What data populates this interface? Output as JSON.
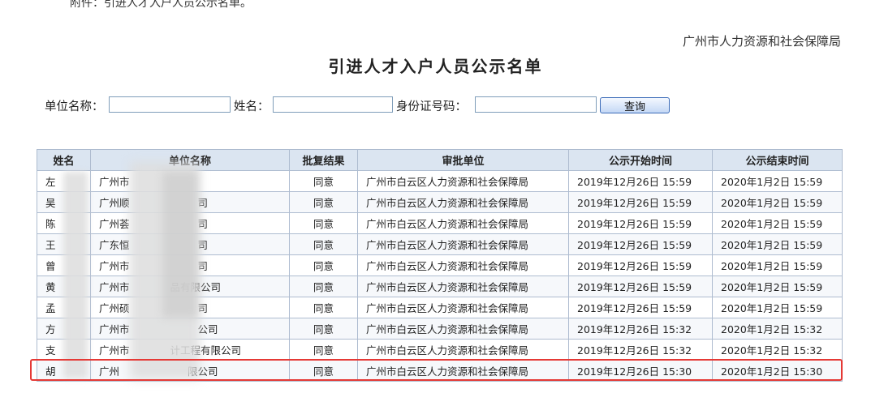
{
  "attachment_text": "附件：引进人才入户人员公示名单。",
  "issuer": "广州市人力资源和社会保障局",
  "page_title": "引进人才入户人员公示名单",
  "search": {
    "unit_label": "单位名称：",
    "unit_value": "",
    "name_label": "姓名：",
    "name_value": "",
    "id_label": "身份证号码：",
    "id_value": "",
    "button_label": "查询"
  },
  "table": {
    "headers": [
      "姓名",
      "单位名称",
      "批复结果",
      "审批单位",
      "公示开始时间",
      "公示结束时间"
    ],
    "rows": [
      {
        "name": "左",
        "unit": "广州市",
        "result": "同意",
        "dept": "广州市白云区人力资源和社会保障局",
        "start": "2019年12月26日  15:59",
        "end": "2020年1月2日  15:59"
      },
      {
        "name": "吴",
        "unit": "广州顺",
        "unit_tail": "司",
        "result": "同意",
        "dept": "广州市白云区人力资源和社会保障局",
        "start": "2019年12月26日  15:59",
        "end": "2020年1月2日  15:59"
      },
      {
        "name": "陈",
        "unit": "广州荟",
        "unit_tail": "司",
        "result": "同意",
        "dept": "广州市白云区人力资源和社会保障局",
        "start": "2019年12月26日  15:59",
        "end": "2020年1月2日  15:59"
      },
      {
        "name": "王",
        "unit": "广东恒",
        "unit_tail": "司",
        "result": "同意",
        "dept": "广州市白云区人力资源和社会保障局",
        "start": "2019年12月26日  15:59",
        "end": "2020年1月2日  15:59"
      },
      {
        "name": "曾",
        "unit": "广州市",
        "unit_tail": "司",
        "result": "同意",
        "dept": "广州市白云区人力资源和社会保障局",
        "start": "2019年12月26日  15:59",
        "end": "2020年1月2日  15:59"
      },
      {
        "name": "黄",
        "unit": "广州市",
        "unit_tail": "品有限公司",
        "result": "同意",
        "dept": "广州市白云区人力资源和社会保障局",
        "start": "2019年12月26日  15:59",
        "end": "2020年1月2日  15:59"
      },
      {
        "name": "孟",
        "unit": "广州硕",
        "unit_tail": "司",
        "result": "同意",
        "dept": "广州市白云区人力资源和社会保障局",
        "start": "2019年12月26日  15:59",
        "end": "2020年1月2日  15:59"
      },
      {
        "name": "方",
        "unit": "广州市",
        "unit_tail": "公司",
        "result": "同意",
        "dept": "广州市白云区人力资源和社会保障局",
        "start": "2019年12月26日  15:32",
        "end": "2020年1月2日  15:32"
      },
      {
        "name": "支",
        "unit": "广州市",
        "unit_tail": "计工程有限公司",
        "result": "同意",
        "dept": "广州市白云区人力资源和社会保障局",
        "start": "2019年12月26日  15:32",
        "end": "2020年1月2日  15:32"
      },
      {
        "name": "胡",
        "unit": "广州",
        "unit_tail": "限公司",
        "result": "同意",
        "dept": "广州市白云区人力资源和社会保障局",
        "start": "2019年12月26日  15:30",
        "end": "2020年1月2日  15:30"
      }
    ]
  },
  "colors": {
    "header_bg": "#dbe5f1",
    "border": "#aebcd0",
    "highlight": "#e53935",
    "button_border": "#3b6bb8"
  }
}
